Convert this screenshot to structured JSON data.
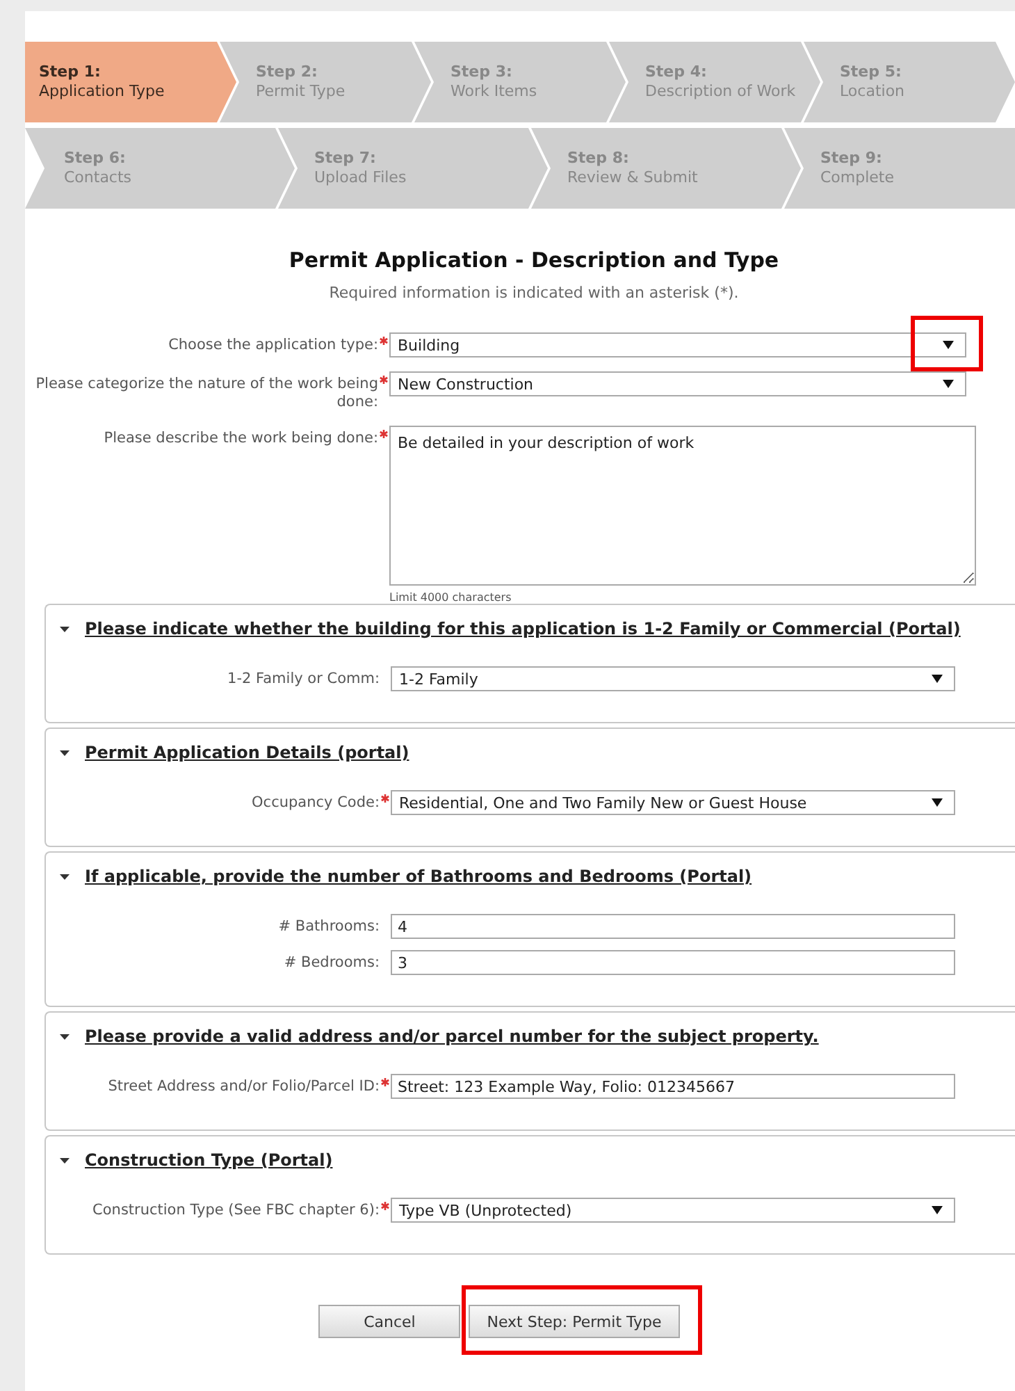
{
  "steps": [
    {
      "number": "Step 1:",
      "name": "Application Type",
      "selected": true
    },
    {
      "number": "Step 2:",
      "name": "Permit Type",
      "selected": false
    },
    {
      "number": "Step 3:",
      "name": "Work Items",
      "selected": false
    },
    {
      "number": "Step 4:",
      "name": "Description of Work",
      "selected": false
    },
    {
      "number": "Step 5:",
      "name": "Location",
      "selected": false
    },
    {
      "number": "Step 6:",
      "name": "Contacts",
      "selected": false
    },
    {
      "number": "Step 7:",
      "name": "Upload Files",
      "selected": false
    },
    {
      "number": "Step 8:",
      "name": "Review & Submit",
      "selected": false
    },
    {
      "number": "Step 9:",
      "name": "Complete",
      "selected": false
    }
  ],
  "title": "Permit Application - Description and Type",
  "subtitle": "Required information is indicated with an asterisk (*).",
  "main_fields": [
    {
      "kind": "select",
      "label": "Choose the application type:",
      "required": true,
      "value": "Building",
      "highlighted": true
    },
    {
      "kind": "select",
      "label": "Please categorize the nature of the work being done:",
      "required": true,
      "value": "New Construction",
      "highlighted": false
    },
    {
      "kind": "textarea",
      "label": "Please describe the work being done:",
      "required": true,
      "value": "Be detailed in your description of work",
      "hint": "Limit 4000 characters",
      "highlighted": false
    }
  ],
  "sections": [
    {
      "title": "Please indicate whether the building for this application is 1-2 Family or Commercial (Portal)",
      "expanded": true,
      "fields": [
        {
          "kind": "select",
          "label": "1-2 Family or Comm:",
          "required": false,
          "value": "1-2 Family"
        }
      ]
    },
    {
      "title": "Permit Application Details (portal)",
      "expanded": true,
      "fields": [
        {
          "kind": "select",
          "label": "Occupancy Code:",
          "required": true,
          "value": "Residential, One and Two Family New or Guest House"
        }
      ]
    },
    {
      "title": "If applicable, provide the number of Bathrooms and Bedrooms (Portal)",
      "expanded": true,
      "fields": [
        {
          "kind": "text",
          "label": "# Bathrooms:",
          "required": false,
          "value": "4"
        },
        {
          "kind": "text",
          "label": "# Bedrooms:",
          "required": false,
          "value": "3"
        }
      ]
    },
    {
      "title": "Please provide a valid address and/or parcel number for the subject property.",
      "expanded": true,
      "fields": [
        {
          "kind": "text",
          "label": "Street Address and/or Folio/Parcel ID:",
          "required": true,
          "value": "Street: 123 Example Way, Folio: 012345667"
        }
      ]
    },
    {
      "title": "Construction Type (Portal)",
      "expanded": true,
      "fields": [
        {
          "kind": "select",
          "label": "Construction Type (See FBC chapter 6):",
          "required": true,
          "value": "Type VB (Unprotected)"
        }
      ]
    }
  ],
  "buttons": [
    {
      "kind": "cancel",
      "label": "Cancel",
      "highlighted": false
    },
    {
      "kind": "next",
      "label": "Next Step: Permit Type",
      "highlighted": true
    }
  ]
}
